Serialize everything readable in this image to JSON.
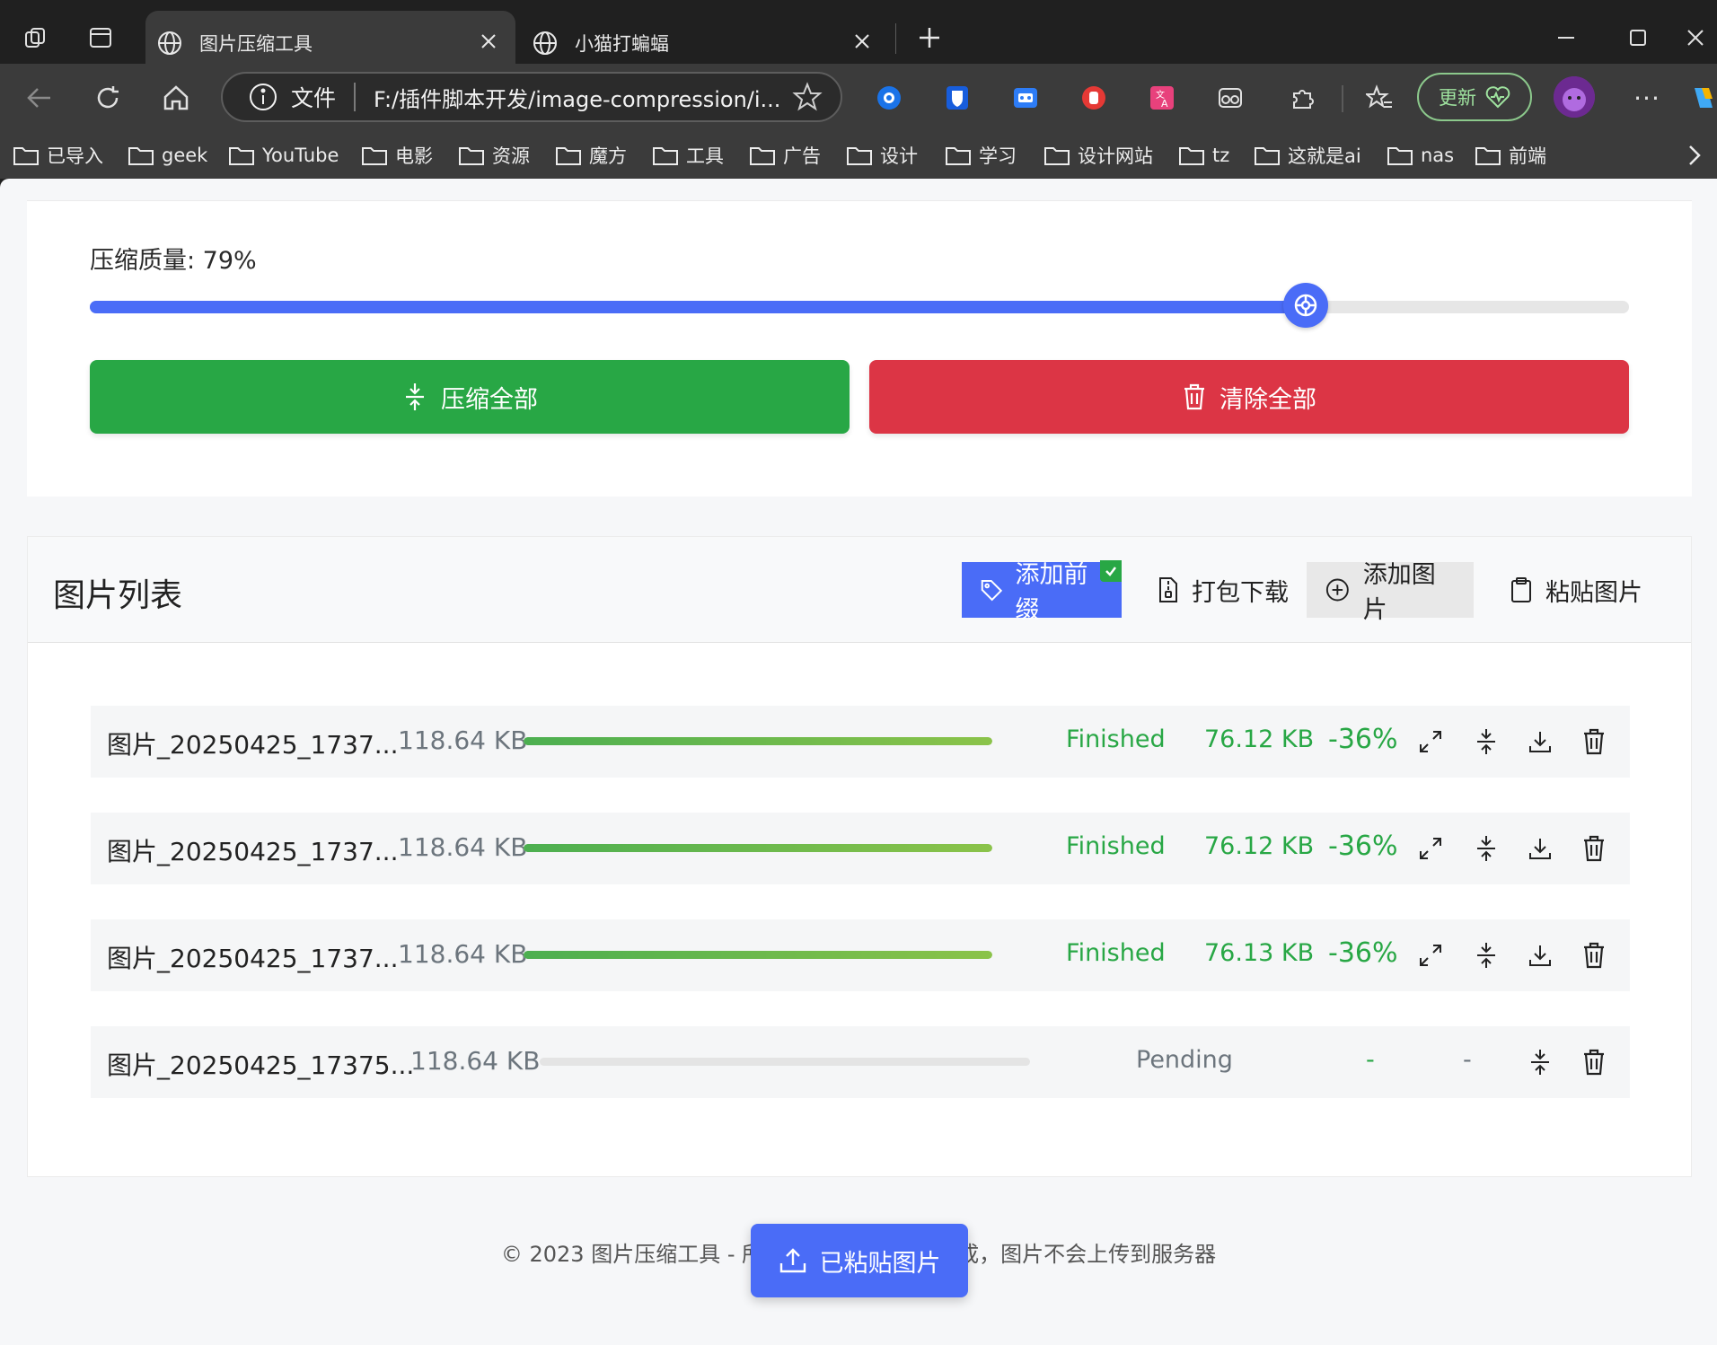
{
  "browser": {
    "tabs": [
      {
        "title": "图片压缩工具",
        "active": true
      },
      {
        "title": "小猫打蝙蝠",
        "active": false
      }
    ],
    "address": {
      "file_label": "文件",
      "url": "F:/插件脚本开发/image-compression/i..."
    },
    "update_label": "更新",
    "bookmarks": [
      "已导入",
      "geek",
      "YouTube",
      "电影",
      "资源",
      "魔方",
      "工具",
      "广告",
      "设计",
      "学习",
      "设计网站",
      "tz",
      "这就是ai",
      "nas",
      "前端"
    ]
  },
  "settings": {
    "quality_label": "压缩质量: 79%",
    "quality_value": 79,
    "compress_all": "压缩全部",
    "clear_all": "清除全部"
  },
  "list": {
    "title": "图片列表",
    "buttons": {
      "add_prefix": "添加前缀",
      "zip_download": "打包下载",
      "add_image": "添加图片",
      "paste_image": "粘贴图片"
    },
    "items": [
      {
        "name": "图片_20250425_1737...",
        "size": "118.64 KB",
        "progress": 1.0,
        "status": "Finished",
        "compressed": "76.12 KB",
        "ratio": "-36%"
      },
      {
        "name": "图片_20250425_1737...",
        "size": "118.64 KB",
        "progress": 1.0,
        "status": "Finished",
        "compressed": "76.12 KB",
        "ratio": "-36%"
      },
      {
        "name": "图片_20250425_1737...",
        "size": "118.64 KB",
        "progress": 1.0,
        "status": "Finished",
        "compressed": "76.13 KB",
        "ratio": "-36%"
      },
      {
        "name": "图片_20250425_17375...",
        "size": "118.64 KB",
        "progress": 0.0,
        "status": "Pending",
        "compressed": "-",
        "ratio": "-"
      }
    ]
  },
  "footer": {
    "text": "© 2023 图片压缩工具 - 所有处理在浏览器中完成，图片不会上传到服务器"
  },
  "toast": {
    "label": "已粘贴图片"
  },
  "colors": {
    "primary": "#4a6cf7",
    "success": "#28a745",
    "danger": "#dc3545"
  }
}
